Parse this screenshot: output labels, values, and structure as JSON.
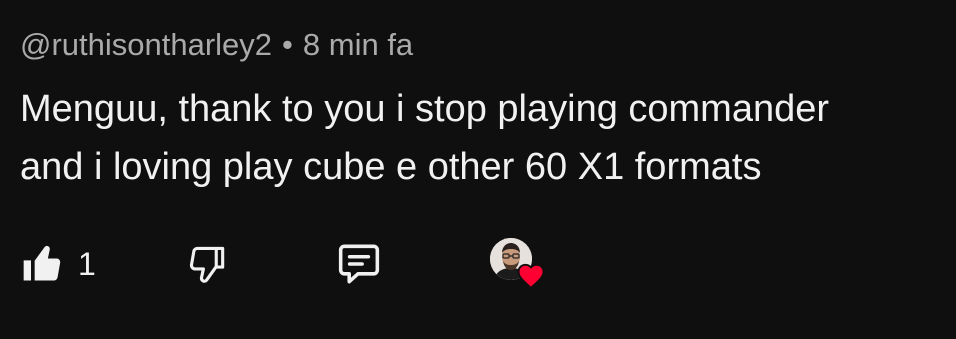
{
  "comment": {
    "author": "@ruthisontharley2",
    "separator": "•",
    "time": "8 min fa",
    "text_lines": [
      "Menguu, thank to you i stop playing commander",
      "and i loving play cube e other 60 X1 formats"
    ]
  },
  "actions": {
    "like_count": "1",
    "like_icon": "thumbs-up-icon",
    "dislike_icon": "thumbs-down-icon",
    "reply_icon": "comment-icon",
    "creator_heart": "heart-icon",
    "heart_color": "#ff0033"
  }
}
